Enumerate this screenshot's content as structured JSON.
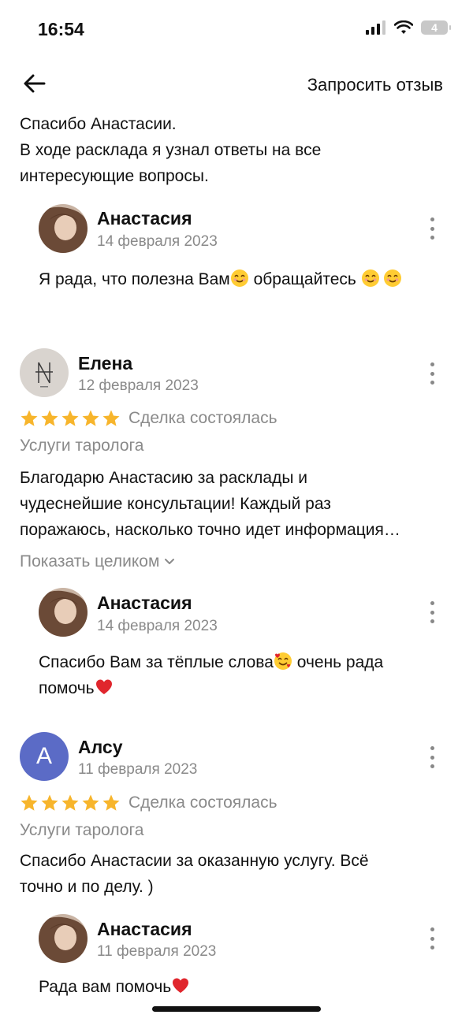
{
  "status_bar": {
    "time": "16:54",
    "battery": "4"
  },
  "topbar": {
    "back_icon": "arrow-left-icon",
    "request_label": "Запросить отзыв"
  },
  "colors": {
    "star": "#F7B52C",
    "muted": "#8A8A8A",
    "alsu_avatar": "#5B6BC6",
    "heart": "#E0262D"
  },
  "reviews": {
    "first": {
      "text_line1": "Спасибо Анастасии.",
      "text_line2": "В ходе расклада я узнал ответы на все",
      "text_line3": "интересующие вопросы.",
      "reply": {
        "name": "Анастасия",
        "date": "14 февраля 2023",
        "text": "Я рада, что полезна Вам",
        "text_after": " обращайтесь "
      }
    },
    "elena": {
      "name": "Елена",
      "date": "12 февраля 2023",
      "rating": 5,
      "deal": "Сделка состоялась",
      "service": "Услуги таролога",
      "text_line1": "Благодарю Анастасию за расклады и",
      "text_line2": "чудеснейшие консультации! Каждый раз",
      "text_line3": "поражаюсь, насколько точно идет информация…",
      "show_more": "Показать целиком",
      "reply": {
        "name": "Анастасия",
        "date": "14 февраля 2023",
        "text_line1": "Спасибо Вам за тёплые слова",
        "text_line1_after": " очень рада",
        "text_line2": "помочь"
      }
    },
    "alsu": {
      "name": "Алсу",
      "avatar_letter": "А",
      "date": "11 февраля 2023",
      "rating": 5,
      "deal": "Сделка состоялась",
      "service": "Услуги таролога",
      "text_line1": "Спасибо Анастасии за оказанную услугу. Всё",
      "text_line2": "точно и по делу. )",
      "reply": {
        "name": "Анастасия",
        "date": "11 февраля 2023",
        "text": "Рада вам помочь"
      }
    }
  }
}
